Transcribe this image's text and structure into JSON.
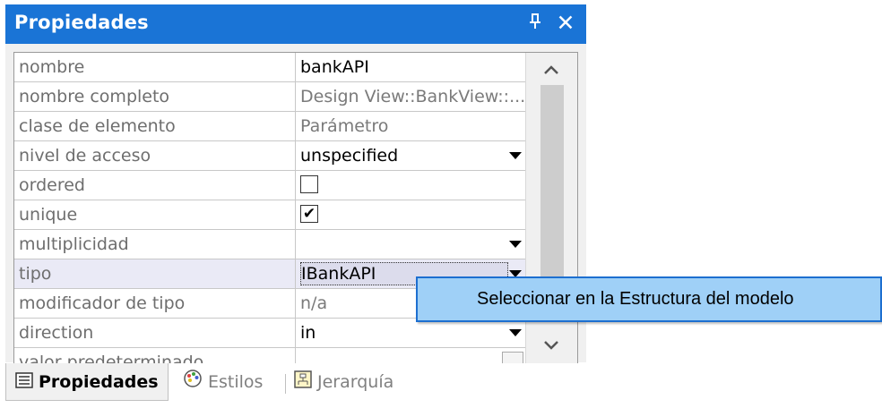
{
  "panel": {
    "title": "Propiedades",
    "pin_glyph": "Ԃ",
    "close_glyph": "✕"
  },
  "properties": [
    {
      "name": "nombre",
      "value": "bankAPI",
      "value_style": "text"
    },
    {
      "name": "nombre completo",
      "value": "Design View::BankView::...",
      "value_style": "gray"
    },
    {
      "name": "clase de elemento",
      "value": "Parámetro",
      "value_style": "gray"
    },
    {
      "name": "nivel de acceso",
      "value": "unspecified",
      "value_style": "dropdown"
    },
    {
      "name": "ordered",
      "value": "",
      "value_style": "checkbox",
      "checked": false
    },
    {
      "name": "unique",
      "value": "✔",
      "value_style": "checkbox",
      "checked": true
    },
    {
      "name": "multiplicidad",
      "value": "",
      "value_style": "dropdown"
    },
    {
      "name": "tipo",
      "value": "IBankAPI",
      "value_style": "dropdown-selected"
    },
    {
      "name": "modificador de tipo",
      "value": "n/a",
      "value_style": "gray"
    },
    {
      "name": "direction",
      "value": "in",
      "value_style": "dropdown"
    },
    {
      "name": "valor predeterminado",
      "value": "",
      "value_style": "ellipsis",
      "button_label": "..."
    }
  ],
  "scrollbar": {
    "up_glyph": "^",
    "down_glyph": "v"
  },
  "tabs": [
    {
      "label": "Propiedades",
      "icon": "properties-list-icon",
      "active": true
    },
    {
      "label": "Estilos",
      "icon": "palette-icon",
      "active": false
    },
    {
      "label": "Jerarquía",
      "icon": "hierarchy-icon",
      "active": false
    }
  ],
  "context_menu": {
    "items": [
      {
        "label": "Seleccionar en la Estructura del modelo"
      }
    ]
  },
  "colors": {
    "title_bar": "#1a74d6",
    "menu_highlight": "#9fd0f7",
    "menu_border": "#1d6fd0"
  }
}
